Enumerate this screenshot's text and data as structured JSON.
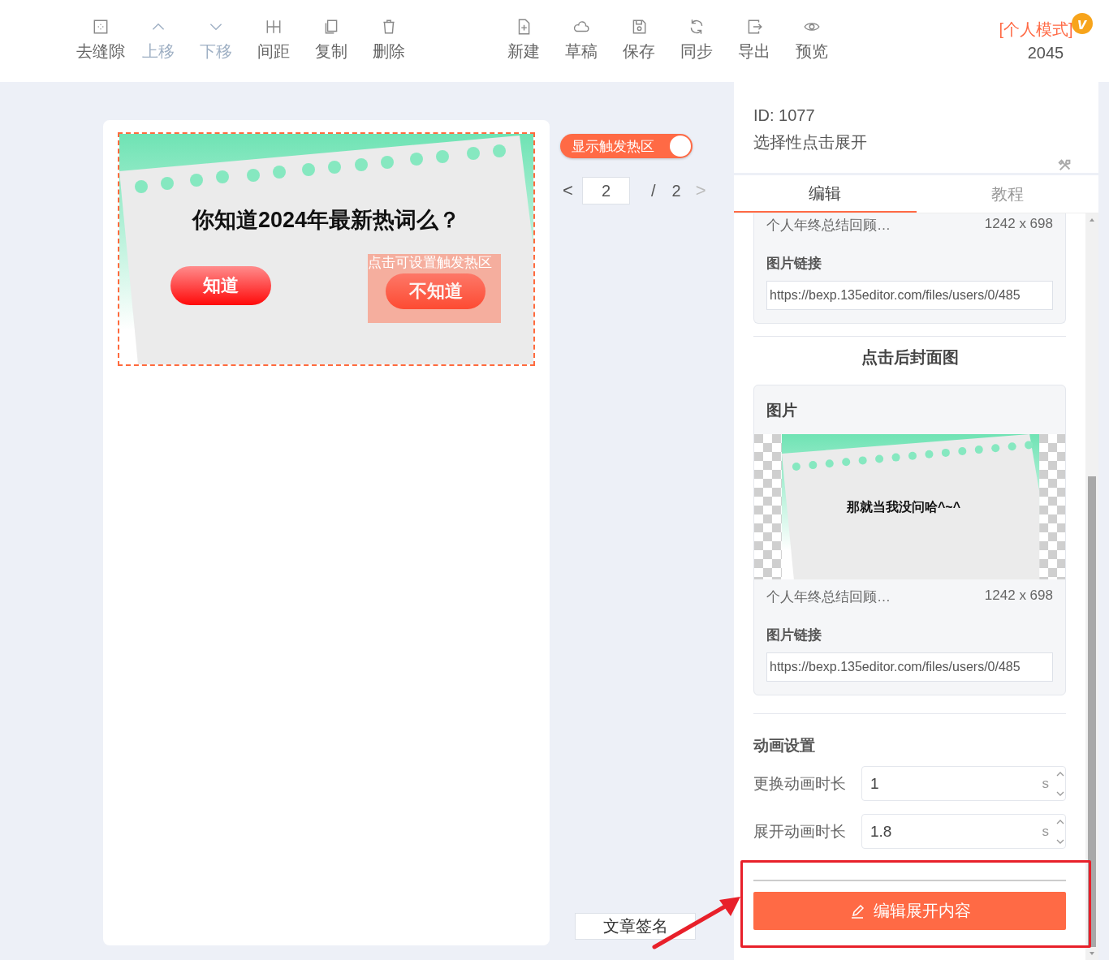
{
  "toolbar": {
    "left": [
      {
        "kind": "gap",
        "label": "去缝隙",
        "disabled": false
      },
      {
        "kind": "up",
        "label": "上移",
        "disabled": true
      },
      {
        "kind": "down",
        "label": "下移",
        "disabled": true
      },
      {
        "kind": "spacing",
        "label": "间距",
        "disabled": false
      },
      {
        "kind": "copy",
        "label": "复制",
        "disabled": false
      },
      {
        "kind": "delete",
        "label": "删除",
        "disabled": false
      }
    ],
    "right": [
      {
        "kind": "new",
        "label": "新建",
        "disabled": false
      },
      {
        "kind": "draft",
        "label": "草稿",
        "disabled": false
      },
      {
        "kind": "save",
        "label": "保存",
        "disabled": false
      },
      {
        "kind": "sync",
        "label": "同步",
        "disabled": false
      },
      {
        "kind": "export",
        "label": "导出",
        "disabled": false
      },
      {
        "kind": "preview",
        "label": "预览",
        "disabled": false
      }
    ]
  },
  "mode": {
    "label": "[个人模式]",
    "badge": "v",
    "count": "2045"
  },
  "canvas": {
    "title": "你知道2024年最新热词么？",
    "buttons": [
      {
        "label": "知道"
      },
      {
        "label": "不知道"
      }
    ],
    "hotspot": "点击可设置触发热区"
  },
  "hotspot_toggle": {
    "label": "显示触发热区",
    "on": true
  },
  "pager": {
    "prev": "<",
    "page": "2",
    "separator": "/",
    "total": "2",
    "next": ">",
    "next_disabled": true
  },
  "signature_button": "文章签名",
  "panel": {
    "id": "ID: 1077",
    "name": "选择性点击展开",
    "tabs": [
      {
        "label": "编辑",
        "selected": true
      },
      {
        "label": "教程",
        "selected": false
      }
    ],
    "cover_card": {
      "file_name": "个人年终总结回顾…",
      "size": "1242 x 698",
      "link_label": "图片链接",
      "link": "https://bexp.135editor.com/files/users/0/485"
    },
    "after_click": {
      "title": "点击后封面图",
      "card_title": "图片",
      "image_text": "那就当我没问哈^~^",
      "file_name": "个人年终总结回顾…",
      "size": "1242 x 698",
      "link_label": "图片链接",
      "link": "https://bexp.135editor.com/files/users/0/485"
    },
    "animation": {
      "title": "动画设置",
      "fields": [
        {
          "label": "更换动画时长",
          "value": "1",
          "unit": "s"
        },
        {
          "label": "展开动画时长",
          "value": "1.8",
          "unit": "s"
        }
      ]
    },
    "edit_button": "编辑展开内容"
  }
}
